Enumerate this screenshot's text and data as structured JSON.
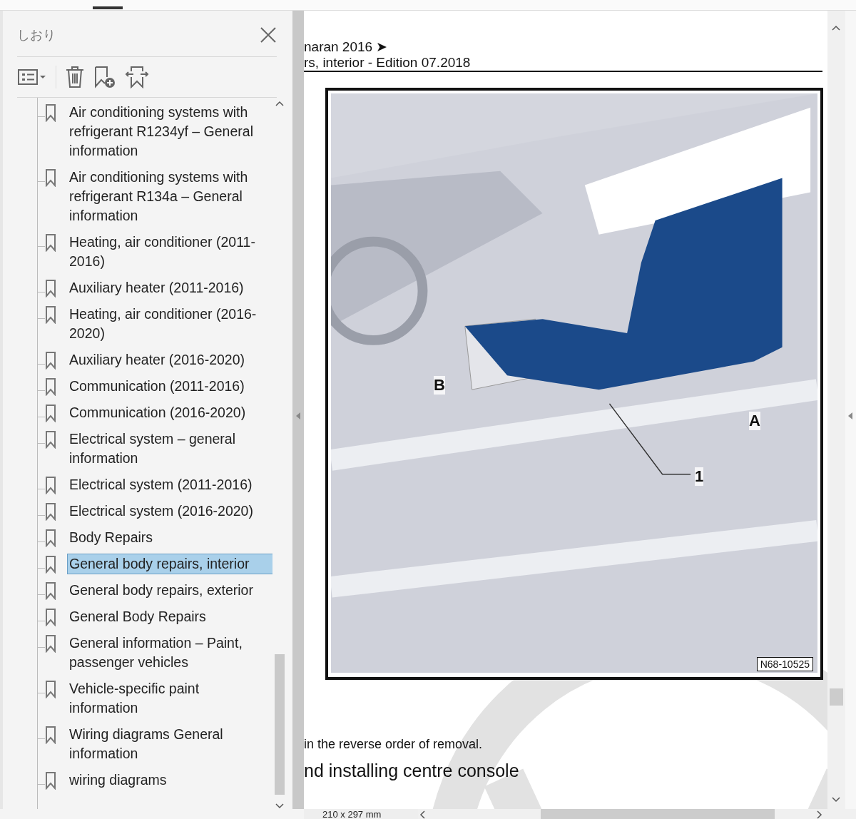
{
  "panel": {
    "title": "しおり"
  },
  "bookmarks": [
    {
      "label": "Air conditioning systems with refrigerant R1234yf – General information",
      "selected": false
    },
    {
      "label": "Air conditioning systems with refrigerant R134a – General information",
      "selected": false
    },
    {
      "label": "Heating, air conditioner (2011-2016)",
      "selected": false
    },
    {
      "label": "Auxiliary heater (2011-2016)",
      "selected": false
    },
    {
      "label": "Heating, air conditioner (2016-2020)",
      "selected": false
    },
    {
      "label": "Auxiliary heater (2016-2020)",
      "selected": false
    },
    {
      "label": "Communication (2011-2016)",
      "selected": false
    },
    {
      "label": "Communication (2016-2020)",
      "selected": false
    },
    {
      "label": "Electrical system – general information",
      "selected": false
    },
    {
      "label": "Electrical system (2011-2016)",
      "selected": false
    },
    {
      "label": "Electrical system (2016-2020)",
      "selected": false
    },
    {
      "label": "Body Repairs",
      "selected": false
    },
    {
      "label": "General body repairs, interior",
      "selected": true
    },
    {
      "label": "General body repairs, exterior",
      "selected": false
    },
    {
      "label": "General Body Repairs",
      "selected": false
    },
    {
      "label": "General information – Paint, passenger vehicles",
      "selected": false
    },
    {
      "label": "Vehicle-specific paint information",
      "selected": false
    },
    {
      "label": "Wiring diagrams General information",
      "selected": false
    },
    {
      "label": "wiring diagrams",
      "selected": false
    }
  ],
  "document": {
    "header_line_1": "naran 2016 ➤",
    "header_line_2": "rs, interior - Edition 07.2018",
    "figure": {
      "label_b": "B",
      "label_a": "A",
      "label_1": "1",
      "code": "N68-10525"
    },
    "text": "in the reverse order of removal.",
    "heading": "nd installing centre console"
  },
  "status_bar": {
    "page_size": "210 x 297 mm"
  }
}
